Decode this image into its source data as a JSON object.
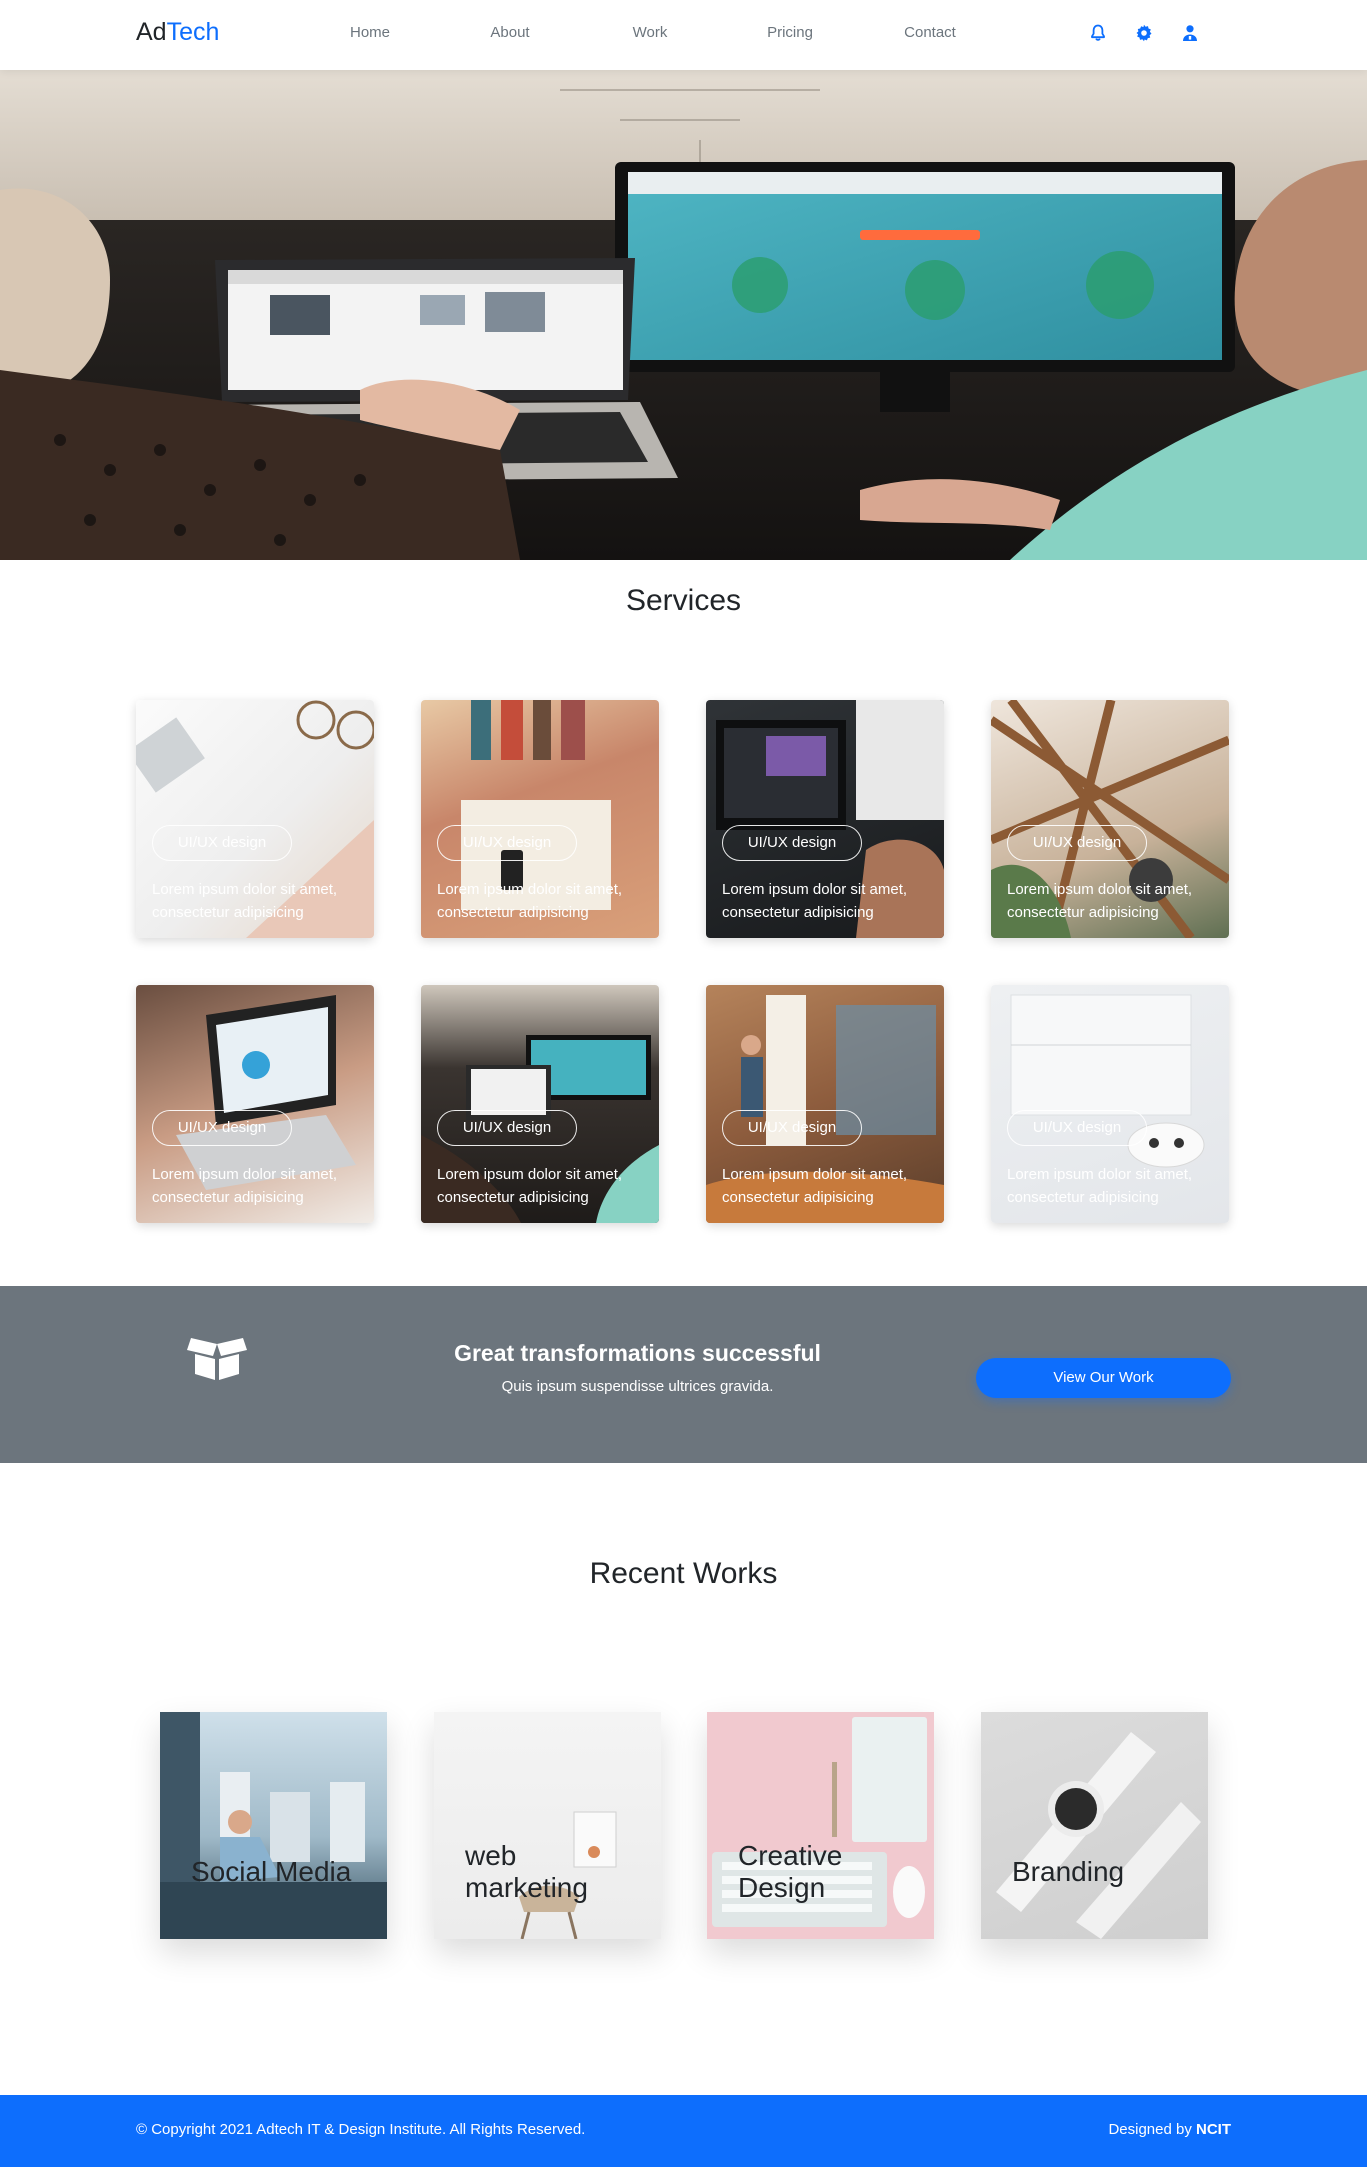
{
  "nav": {
    "brand_prefix": "Ad",
    "brand_accent": "Tech",
    "links": [
      "Home",
      "About",
      "Work",
      "Pricing",
      "Contact"
    ],
    "icons": [
      "bell-icon",
      "gear-icon",
      "user-icon"
    ]
  },
  "services": {
    "title": "Services",
    "cards": [
      {
        "tag": "UI/UX design",
        "text": "Lorem ipsum dolor sit amet, consectetur adipisicing"
      },
      {
        "tag": "UI/UX design",
        "text": "Lorem ipsum dolor sit amet, consectetur adipisicing"
      },
      {
        "tag": "UI/UX design",
        "text": "Lorem ipsum dolor sit amet, consectetur adipisicing"
      },
      {
        "tag": "UI/UX design",
        "text": "Lorem ipsum dolor sit amet, consectetur adipisicing"
      },
      {
        "tag": "UI/UX design",
        "text": "Lorem ipsum dolor sit amet, consectetur adipisicing"
      },
      {
        "tag": "UI/UX design",
        "text": "Lorem ipsum dolor sit amet, consectetur adipisicing"
      },
      {
        "tag": "UI/UX design",
        "text": "Lorem ipsum dolor sit amet, consectetur adipisicing"
      },
      {
        "tag": "UI/UX design",
        "text": "Lorem ipsum dolor sit amet, consectetur adipisicing"
      }
    ]
  },
  "banner": {
    "heading": "Great transformations successful",
    "subtext": "Quis ipsum suspendisse ultrices gravida.",
    "button_label": "View Our Work",
    "icon": "open-box-icon"
  },
  "recent_works": {
    "title": "Recent Works",
    "items": [
      {
        "label": "Social Media"
      },
      {
        "label_line1": "web",
        "label_line2": "marketing"
      },
      {
        "label_line1": "Creative",
        "label_line2": "Design"
      },
      {
        "label": "Branding"
      }
    ]
  },
  "footer": {
    "copyright": "© Copyright 2021 Adtech IT & Design Institute. All Rights Reserved.",
    "designed_by_prefix": "Designed by",
    "designed_by_name": "NCIT"
  },
  "colors": {
    "accent": "#0d6efd",
    "banner_bg": "#6c757d",
    "nav_link": "#6c757d",
    "text_dark": "#212529"
  }
}
